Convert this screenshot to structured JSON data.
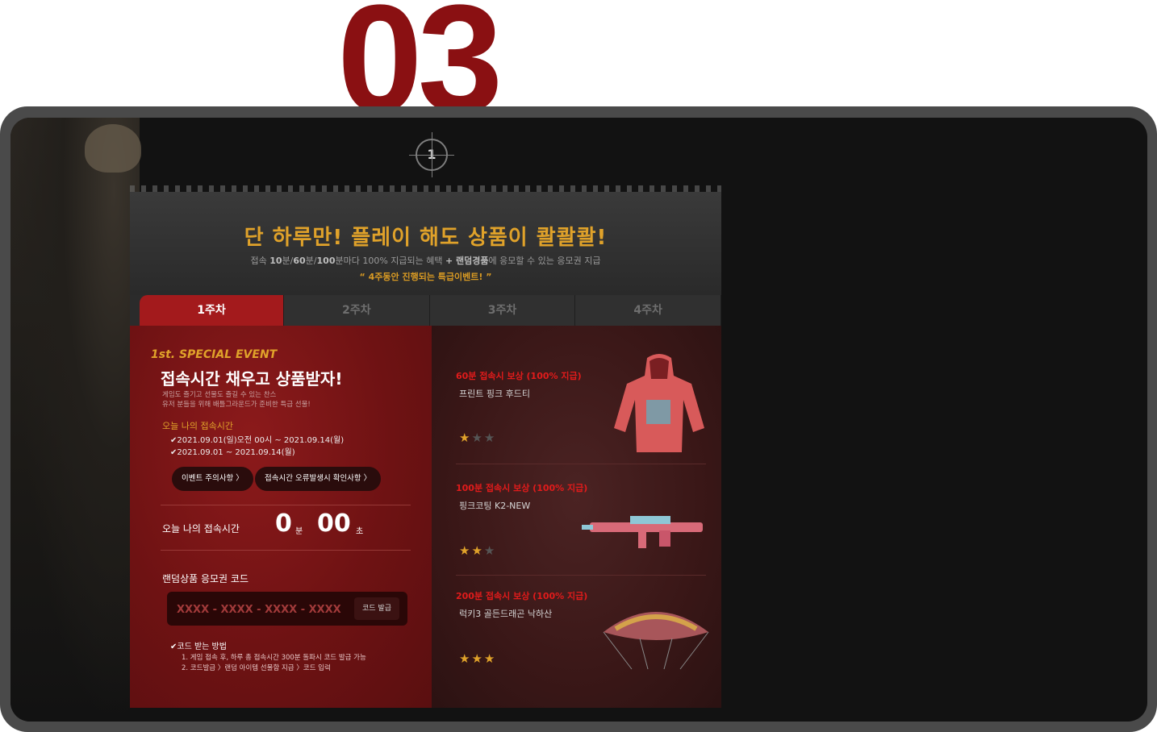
{
  "section_number": "03",
  "badge_number": "1",
  "header": {
    "title": "단 하루만! 플레이 해도 상품이 콸콸콸!",
    "subtitle_parts": [
      "접속 ",
      "10",
      "분/",
      "60",
      "분/",
      "100",
      "분마다 100% 지급되는 혜택 ",
      "+ 랜덤경품",
      "에 응모할 수 있는 응모권 지급"
    ],
    "note": "“ 4주동안 진행되는 특급이벤트! ”"
  },
  "tabs": [
    {
      "label": "1주차",
      "active": true
    },
    {
      "label": "2주차",
      "active": false
    },
    {
      "label": "3주차",
      "active": false
    },
    {
      "label": "4주차",
      "active": false
    }
  ],
  "event": {
    "tag": "1st. SPECIAL EVENT",
    "title": "접속시간 채우고 상품받자!",
    "desc_line1": "게임도 즐기고 선물도 즐길 수 있는 찬스",
    "desc_line2": "유저 분들을 위해 배틀그라운드가 준비한 특급 선물!",
    "today_label": "오늘 나의 접속시간",
    "periods": [
      "✔2021.09.01(일)오전 00시 ~ 2021.09.14(월)",
      "✔2021.09.01 ~ 2021.09.14(월)"
    ],
    "notice_button": "이벤트 주의사항 〉",
    "error_button": "접속시간 오류발생시 확인사항 〉",
    "timer_label": "오늘 나의 접속시간",
    "timer_minutes": "0",
    "timer_minutes_unit": "분",
    "timer_seconds": "00",
    "timer_seconds_unit": "초",
    "code_label": "랜덤상품 응모권 코드",
    "code_placeholder": "XXXX - XXXX - XXXX - XXXX",
    "code_button": "코드 발급",
    "howto_title": "✔코드 받는 방법",
    "howto_steps": [
      "1. 게임 접속 후, 하루 총 접속시간 300분 돌파시 코드 발급 가능",
      "2. 코드발급 〉랜덤 아이템 선물함 지급 〉코드 입력"
    ]
  },
  "rewards": [
    {
      "title": "60분 접속시 보상 (100% 지급)",
      "name": "프린트 핑크 후드티",
      "stars": 1,
      "icon": "hoodie-icon"
    },
    {
      "title": "100분 접속시 보상 (100% 지급)",
      "name": "핑크코팅 K2-NEW",
      "stars": 2,
      "icon": "rifle-icon"
    },
    {
      "title": "200분 접속시 보상 (100% 지급)",
      "name": "럭키3 골든드래곤 낙하산",
      "stars": 3,
      "icon": "parachute-icon"
    }
  ],
  "star_glyph": "★",
  "colors": {
    "accent_gold": "#e0a22a",
    "accent_red": "#a31a1c",
    "reward_red": "#e11b1b",
    "number_red": "#8a1012"
  }
}
